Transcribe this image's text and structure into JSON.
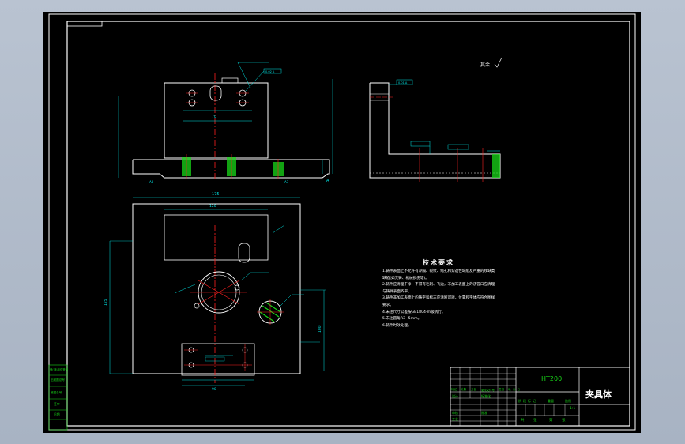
{
  "title_block": {
    "material": "HT200",
    "part_name": "夹具体",
    "scale": "1:1",
    "col_labels": [
      "标记",
      "处数",
      "分区",
      "更改文件号",
      "签名",
      "年、月、日"
    ],
    "row_labels": [
      "设计",
      "审核",
      "工艺"
    ],
    "mid_labels": [
      "标准化",
      "批准"
    ],
    "stage_labels": [
      "阶",
      "段",
      "标",
      "记",
      "重量",
      "比例"
    ],
    "footer_labels": [
      "共",
      "张",
      "第",
      "张"
    ]
  },
  "notes": {
    "title": "技术要求",
    "lines": [
      "1.铸件表面上不允许有冷隔、裂纹、缩孔和穿透性缺陷及严重的残缺类",
      "缺陷(如欠铸、机械损伤等)。",
      "2.铸件应清理干净，不得有毛刺、飞边，非加工表面上的浇冒口应清理",
      "与铸件表面齐平。",
      "3.铸件非加工表面上的铸字和标志应清晰可辨，位置和字体应符合图样",
      "要求。",
      "4.未注尺寸公差按GB1804-m级执行。",
      "5.未注圆角R3~5mm。",
      "6.铸件时效处理。"
    ]
  },
  "left_strip": {
    "labels": [
      "借(通)用件登记",
      "旧底图总号",
      "底图总号",
      "签字",
      "日期"
    ]
  },
  "annotations": {
    "roughness": "其余",
    "dim_top": "175",
    "dim_mid": "70",
    "dim_left": "125",
    "dim_right": "100",
    "dim_plan": "120",
    "dim_bottom": "90",
    "tol_1": "0.02 A",
    "tol_2": "0.01 A"
  },
  "colors": {
    "outline": "#ffffff",
    "dimension": "#00e5e5",
    "center": "#ff2020",
    "hatch": "#18d818",
    "note": "#ffffff",
    "title_text": "#18d818",
    "part_name": "#ffffff"
  }
}
